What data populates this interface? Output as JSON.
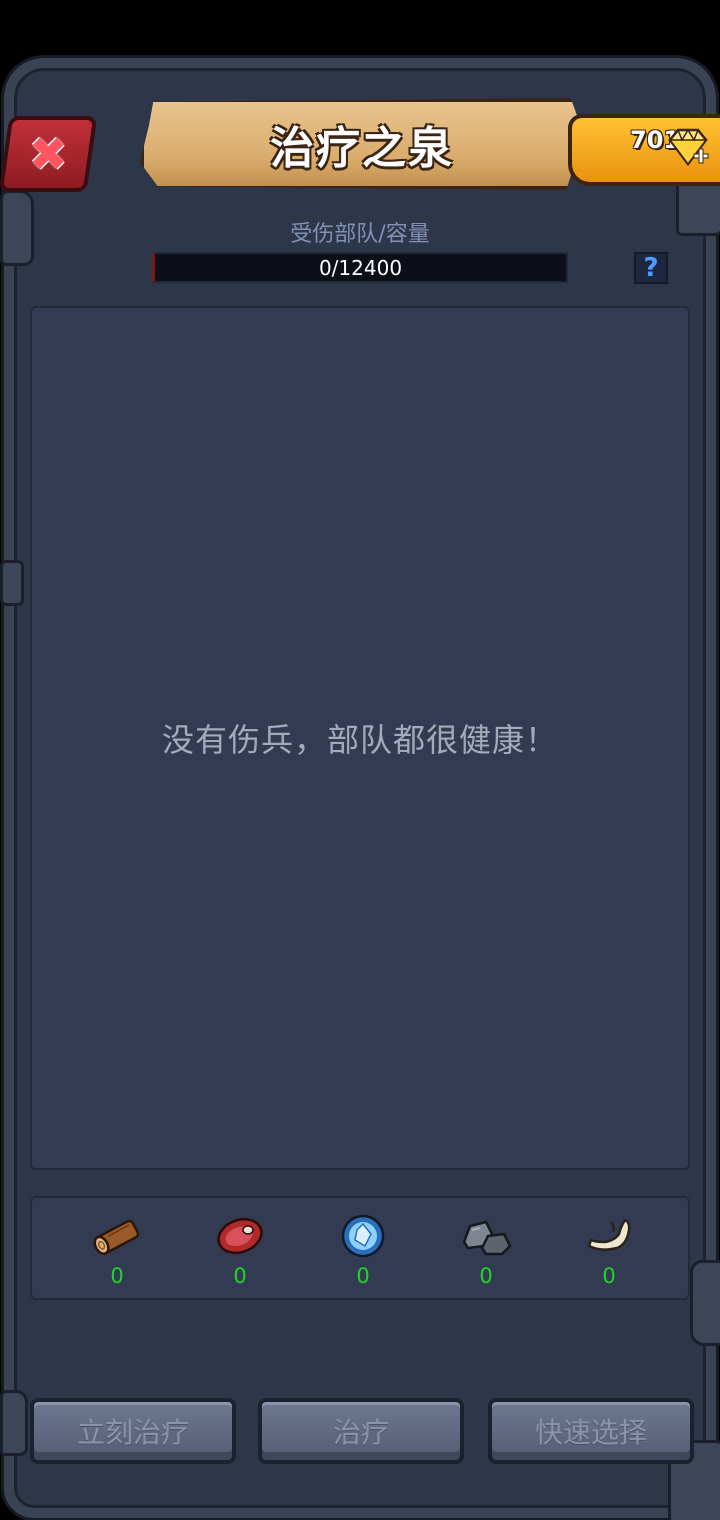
{
  "header": {
    "title": "治疗之泉",
    "close_icon": "close-x-icon",
    "gems": "701",
    "gem_icon": "diamond-plus-icon"
  },
  "capacity": {
    "label": "受伤部队/容量",
    "value": "0/12400",
    "fill_fraction": 0,
    "help": "?"
  },
  "list": {
    "empty_message": "没有伤兵，部队都很健康！"
  },
  "resources": [
    {
      "icon": "wood-icon",
      "amount": "0"
    },
    {
      "icon": "meat-icon",
      "amount": "0"
    },
    {
      "icon": "crystal-icon",
      "amount": "0"
    },
    {
      "icon": "stone-icon",
      "amount": "0"
    },
    {
      "icon": "bone-icon",
      "amount": "0"
    }
  ],
  "buttons": {
    "instant_heal": "立刻治疗",
    "heal": "治疗",
    "quick_select": "快速选择"
  },
  "colors": {
    "panel": "#323b52",
    "frame": "#2e3649",
    "resource_amount": "#22d32a",
    "banner": "#e8c48e",
    "gem_tab": "#ffc233"
  }
}
